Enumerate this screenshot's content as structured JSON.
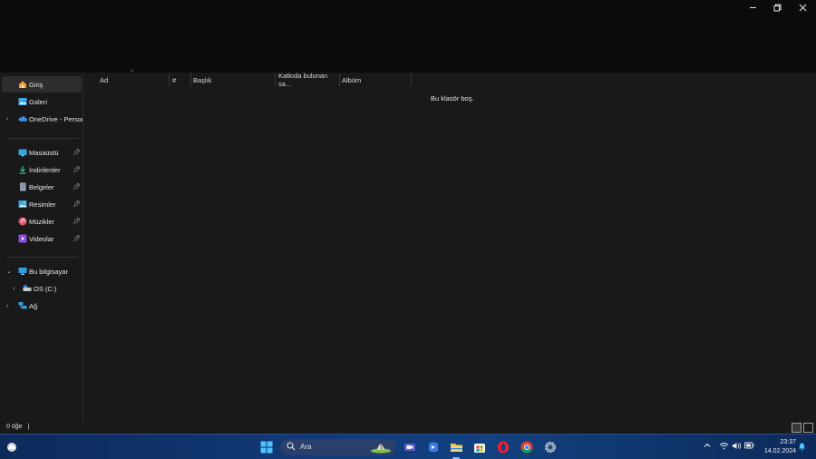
{
  "window": {
    "controls": {
      "minimize_icon": "minimize-icon",
      "maximize_icon": "restore-icon",
      "close_icon": "close-icon"
    }
  },
  "sidebar": {
    "items": [
      {
        "label": "Giriş",
        "icon": "home-icon",
        "selected": true
      },
      {
        "label": "Galeri",
        "icon": "gallery-icon"
      },
      {
        "label": "OneDrive - Persona",
        "icon": "cloud-icon",
        "expandable": true
      },
      {
        "label": "Masaüstü",
        "icon": "desktop-icon",
        "pinned": true
      },
      {
        "label": "İndirilenler",
        "icon": "download-icon",
        "pinned": true
      },
      {
        "label": "Belgeler",
        "icon": "document-icon",
        "pinned": true
      },
      {
        "label": "Resimler",
        "icon": "pictures-icon",
        "pinned": true
      },
      {
        "label": "Müzikler",
        "icon": "music-icon",
        "pinned": true
      },
      {
        "label": "Videolar",
        "icon": "video-icon",
        "pinned": true
      },
      {
        "label": "Bu bilgisayar",
        "icon": "computer-icon",
        "expanded": true
      },
      {
        "label": "OS (C:)",
        "icon": "drive-icon",
        "expandable": true
      },
      {
        "label": "Ağ",
        "icon": "network-icon",
        "expandable": true
      }
    ]
  },
  "content": {
    "columns": [
      "Ad",
      "#",
      "Başlık",
      "Katkıda bulunan sa...",
      "Albüm"
    ],
    "empty_message": "Bu klasör boş."
  },
  "status": {
    "item_count": "0 öğe",
    "separator": "|"
  },
  "taskbar": {
    "search_label": "Ara",
    "clock_time": "23:37",
    "clock_date": "14.02.2024",
    "apps": [
      "windows-start-icon",
      "meet-icon",
      "copilot-icon",
      "file-explorer-icon",
      "store-icon",
      "opera-icon",
      "chrome-icon",
      "settings-icon"
    ]
  },
  "colors": {
    "accent": "#4cc2ff",
    "taskbar": "#12417f",
    "background": "#191919"
  }
}
